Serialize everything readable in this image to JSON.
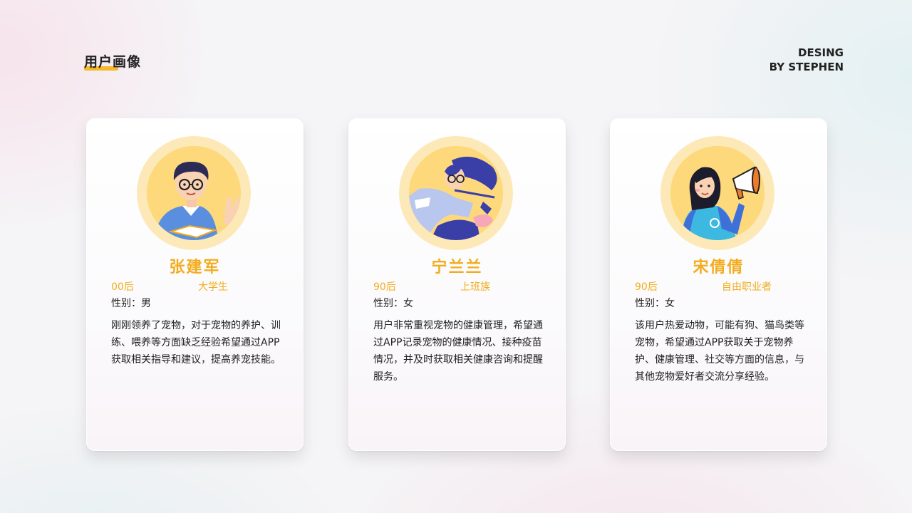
{
  "header": {
    "title": "用户画像",
    "credit_line1": "DESING",
    "credit_line2": "BY STEPHEN"
  },
  "colors": {
    "accent": "#f2ac1e",
    "avatar_ring": "#fde9b8",
    "avatar_fill": "#fdd97c"
  },
  "personas": [
    {
      "name": "张建军",
      "age": "00后",
      "occupation": "大学生",
      "gender": "性别：男",
      "description": "刚刚领养了宠物，对于宠物的养护、训练、喂养等方面缺乏经验希望通过APP获取相关指导和建议，提高养宠技能。",
      "avatar_icon": "student-with-glasses-icon"
    },
    {
      "name": "宁兰兰",
      "age": "90后",
      "occupation": "上班族",
      "gender": "性别：女",
      "description": "用户非常重视宠物的健康管理，希望通过APP记录宠物的健康情况、接种疫苗情况，并及时获取相关健康咨询和提醒服务。",
      "avatar_icon": "office-worker-icon"
    },
    {
      "name": "宋倩倩",
      "age": "90后",
      "occupation": "自由职业者",
      "gender": "性别：女",
      "description": "该用户热爱动物，可能有狗、猫鸟类等宠物，希望通过APP获取关于宠物养护、健康管理、社交等方面的信息，与其他宠物爱好者交流分享经验。",
      "avatar_icon": "woman-with-megaphone-icon"
    }
  ]
}
